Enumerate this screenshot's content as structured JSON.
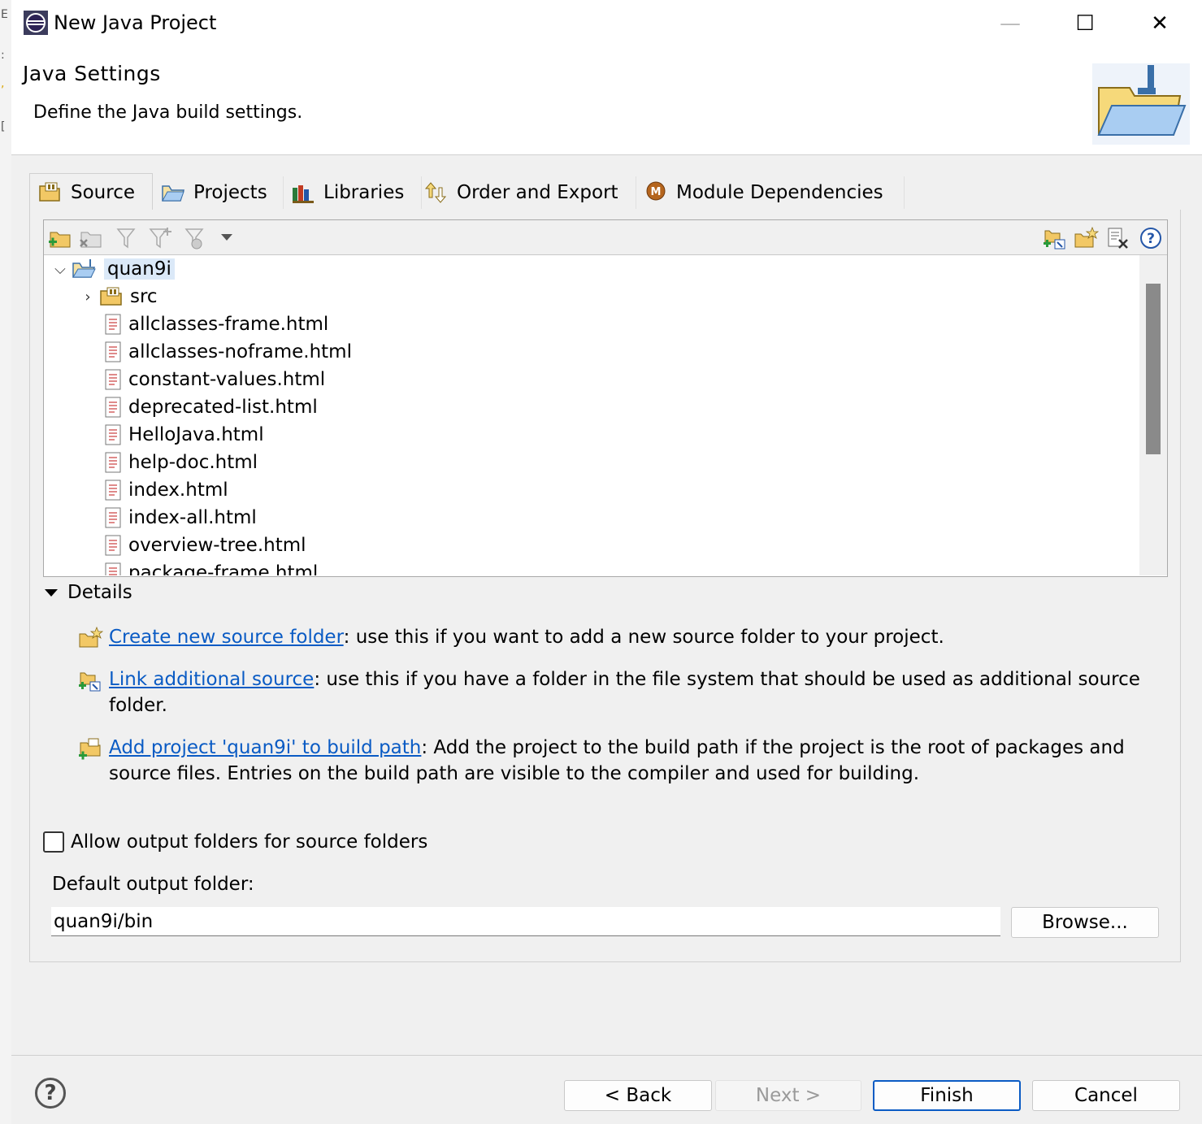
{
  "window": {
    "title": "New Java Project",
    "controls": {
      "minimize": "—",
      "maximize": "☐",
      "close": "✕"
    }
  },
  "header": {
    "title": "Java Settings",
    "subtitle": "Define the Java build settings."
  },
  "tabs": [
    {
      "label": "Source",
      "icon": "source-folder-icon",
      "active": true
    },
    {
      "label": "Projects",
      "icon": "projects-icon"
    },
    {
      "label": "Libraries",
      "icon": "libraries-icon"
    },
    {
      "label": "Order and Export",
      "icon": "order-export-icon"
    },
    {
      "label": "Module Dependencies",
      "icon": "module-dependencies-icon"
    }
  ],
  "tree": {
    "root": "quan9i",
    "items": [
      {
        "label": "src",
        "type": "folder"
      },
      {
        "label": "allclasses-frame.html",
        "type": "file"
      },
      {
        "label": "allclasses-noframe.html",
        "type": "file"
      },
      {
        "label": "constant-values.html",
        "type": "file"
      },
      {
        "label": "deprecated-list.html",
        "type": "file"
      },
      {
        "label": "HelloJava.html",
        "type": "file"
      },
      {
        "label": "help-doc.html",
        "type": "file"
      },
      {
        "label": "index.html",
        "type": "file"
      },
      {
        "label": "index-all.html",
        "type": "file"
      },
      {
        "label": "overview-tree.html",
        "type": "file"
      },
      {
        "label": "package-frame.html",
        "type": "file"
      }
    ]
  },
  "details": {
    "heading": "Details",
    "items": [
      {
        "link": "Create new source folder",
        "text": ": use this if you want to add a new source folder to your project."
      },
      {
        "link": "Link additional source",
        "text": ": use this if you have a folder in the file system that should be used as additional source folder."
      },
      {
        "link": "Add project 'quan9i' to build path",
        "text": ": Add the project to the build path if the project is the root of packages and source files. Entries on the build path are visible to the compiler and used for building."
      }
    ]
  },
  "allow_output_label": "Allow output folders for source folders",
  "output": {
    "label": "Default output folder:",
    "value": "quan9i/bin",
    "browse_label": "Browse..."
  },
  "buttons": {
    "back": "< Back",
    "next": "Next >",
    "finish": "Finish",
    "cancel": "Cancel",
    "help": "?"
  },
  "colors": {
    "link": "#0a5bc4",
    "selection": "#dbe9f8"
  }
}
